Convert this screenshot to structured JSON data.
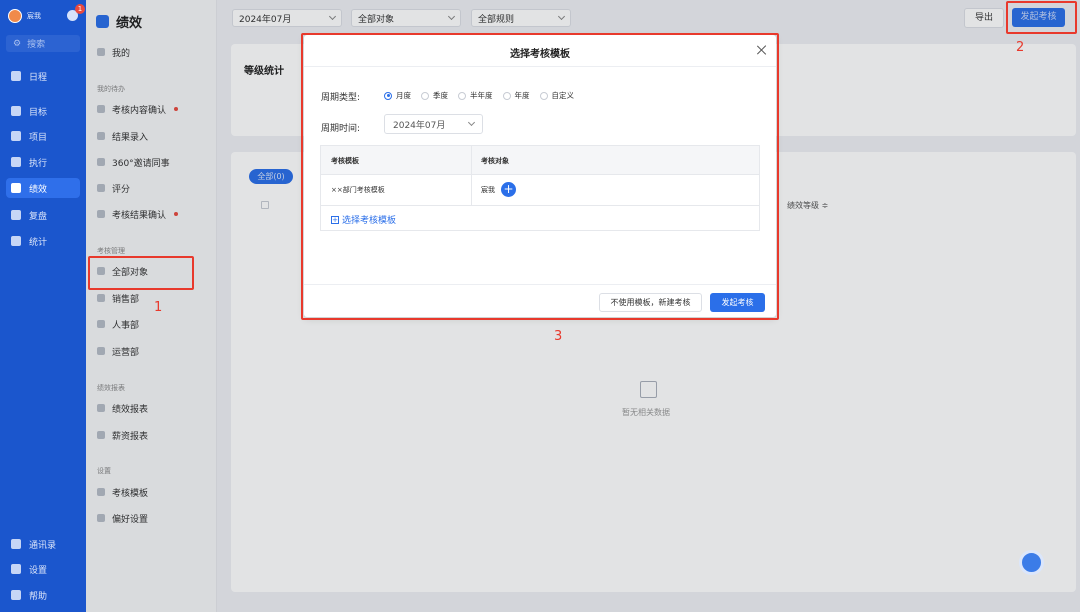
{
  "rail": {
    "user_name": "宸我",
    "badge_count": "1",
    "search_placeholder": "搜索",
    "items": [
      {
        "label": "日程",
        "icon": "calendar-icon"
      },
      {
        "label": "目标",
        "icon": "target-icon"
      },
      {
        "label": "项目",
        "icon": "cube-icon"
      },
      {
        "label": "执行",
        "icon": "list-icon"
      },
      {
        "label": "绩效",
        "icon": "chart-icon",
        "active": true
      },
      {
        "label": "复盘",
        "icon": "review-icon"
      },
      {
        "label": "统计",
        "icon": "pie-icon"
      }
    ],
    "bottom": [
      {
        "label": "通讯录",
        "icon": "contacts-icon"
      },
      {
        "label": "设置",
        "icon": "gear-icon"
      },
      {
        "label": "帮助",
        "icon": "help-icon"
      }
    ]
  },
  "side": {
    "title": "绩效",
    "mine": "我的",
    "group_todo": "我的待办",
    "todo_items": [
      "考核内容确认",
      "结果录入",
      "360°邀请同事",
      "评分",
      "考核结果确认"
    ],
    "group_manage": "考核管理",
    "manage_items": [
      "全部对象",
      "销售部",
      "人事部",
      "运营部"
    ],
    "group_report": "绩效报表",
    "report_items": [
      "绩效报表",
      "薪资报表"
    ],
    "group_settings": "设置",
    "settings_items": [
      "考核模板",
      "偏好设置"
    ]
  },
  "main": {
    "filter_month": "2024年07月",
    "filter_object": "全部对象",
    "filter_rule": "全部规则",
    "export": "导出",
    "start": "发起考核",
    "grade_stats": "等级统计",
    "pill_all": "全部(0)",
    "col_grade": "绩效等级 ≑",
    "empty_text": "暂无相关数据"
  },
  "modal": {
    "title": "选择考核模板",
    "period_type_label": "周期类型:",
    "period_options": [
      "月度",
      "季度",
      "半年度",
      "年度",
      "自定义"
    ],
    "period_selected": 0,
    "period_time_label": "周期时间:",
    "period_time_value": "2024年07月",
    "col_template": "考核模板",
    "col_object": "考核对象",
    "row_template": "××部门考核模板",
    "row_object": "宸我",
    "add_template": "选择考核模板",
    "btn_no_template": "不使用模板，新建考核",
    "btn_launch": "发起考核"
  },
  "annotations": [
    "1",
    "2",
    "3"
  ]
}
